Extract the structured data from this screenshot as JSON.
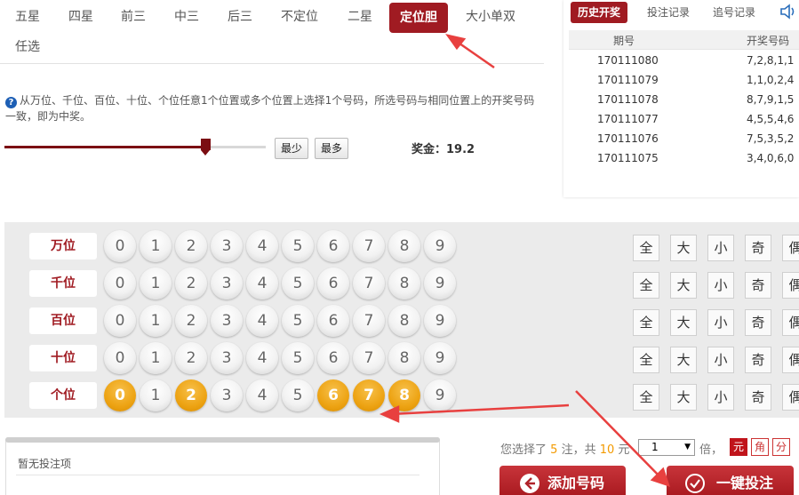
{
  "tabs": [
    {
      "label": "五星"
    },
    {
      "label": "四星"
    },
    {
      "label": "前三"
    },
    {
      "label": "中三"
    },
    {
      "label": "后三"
    },
    {
      "label": "不定位"
    },
    {
      "label": "二星"
    },
    {
      "label": "定位胆"
    },
    {
      "label": "大小单双"
    },
    {
      "label": "任选"
    }
  ],
  "active_tab": "定位胆",
  "description": "从万位、千位、百位、十位、个位任意1个位置或多个位置上选择1个号码，所选号码与相同位置上的开奖号码一致，即为中奖。",
  "slider": {
    "level": 0.77,
    "min_label": "最少",
    "max_label": "最多"
  },
  "prize": {
    "label": "奖金：",
    "value": "19.2"
  },
  "history": {
    "tabs": [
      "历史开奖",
      "投注记录",
      "追号记录"
    ],
    "columns": [
      "期号",
      "开奖号码"
    ],
    "rows": [
      {
        "issue": "170111080",
        "numbers": "7,2,8,1,1"
      },
      {
        "issue": "170111079",
        "numbers": "1,1,0,2,4"
      },
      {
        "issue": "170111078",
        "numbers": "8,7,9,1,5"
      },
      {
        "issue": "170111077",
        "numbers": "4,5,5,4,6"
      },
      {
        "issue": "170111076",
        "numbers": "7,5,3,5,2"
      },
      {
        "issue": "170111075",
        "numbers": "3,4,0,6,0"
      }
    ]
  },
  "positions": [
    {
      "label": "万位",
      "selected": []
    },
    {
      "label": "千位",
      "selected": []
    },
    {
      "label": "百位",
      "selected": []
    },
    {
      "label": "十位",
      "selected": []
    },
    {
      "label": "个位",
      "selected": [
        0,
        2,
        6,
        7,
        8
      ]
    }
  ],
  "digits": [
    "0",
    "1",
    "2",
    "3",
    "4",
    "5",
    "6",
    "7",
    "8",
    "9"
  ],
  "filters": [
    "全",
    "大",
    "小",
    "奇",
    "偶"
  ],
  "bet_list": {
    "empty_text": "暂无投注项"
  },
  "summary": {
    "prefix": "您选择了",
    "count": "5",
    "mid": "注，共",
    "amount": "10",
    "suffix": "元"
  },
  "multiplier": {
    "value": "1",
    "unit": "倍，"
  },
  "currency_units": [
    "元",
    "角",
    "分"
  ],
  "actions": {
    "add": "添加号码",
    "quick_bet": "一键投注"
  },
  "colors": {
    "accent": "#a01b22",
    "selected_ball": "#eda313",
    "arrow": "#e8403f"
  }
}
